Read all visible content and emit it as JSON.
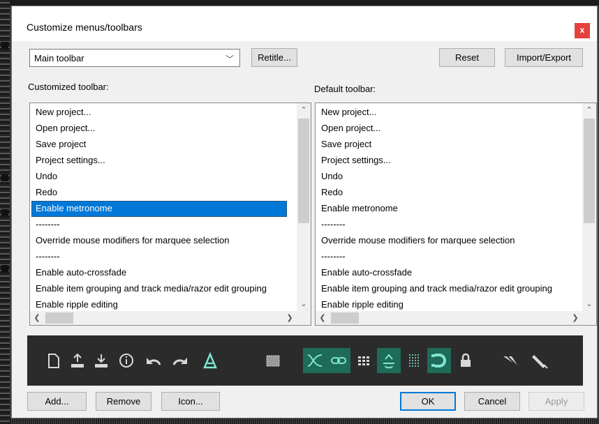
{
  "dialog": {
    "title": "Customize menus/toolbars",
    "close_glyph": "x"
  },
  "toolbar_select": {
    "value": "Main toolbar",
    "chevron": "﹀"
  },
  "buttons": {
    "retitle": "Retitle...",
    "reset": "Reset",
    "import_export": "Import/Export",
    "add": "Add...",
    "remove": "Remove",
    "icon": "Icon...",
    "ok": "OK",
    "cancel": "Cancel",
    "apply": "Apply"
  },
  "labels": {
    "customized": "Customized toolbar:",
    "default": "Default toolbar:"
  },
  "customized_items": [
    "New project...",
    "Open project...",
    "Save project",
    "Project settings...",
    "Undo",
    "Redo",
    "Enable metronome",
    "--------",
    "Override mouse modifiers for marquee selection",
    "--------",
    "Enable auto-crossfade",
    "Enable item grouping and track media/razor edit grouping",
    "Enable ripple editing"
  ],
  "customized_selected_index": 6,
  "default_items": [
    "New project...",
    "Open project...",
    "Save project",
    "Project settings...",
    "Undo",
    "Redo",
    "Enable metronome",
    "--------",
    "Override mouse modifiers for marquee selection",
    "--------",
    "Enable auto-crossfade",
    "Enable item grouping and track media/razor edit grouping",
    "Enable ripple editing"
  ],
  "toolbar_preview_icons": [
    {
      "name": "new-project-icon",
      "active": false
    },
    {
      "name": "open-project-icon",
      "active": false
    },
    {
      "name": "save-project-icon",
      "active": false
    },
    {
      "name": "project-settings-icon",
      "active": false
    },
    {
      "name": "undo-icon",
      "active": false
    },
    {
      "name": "redo-icon",
      "active": false
    },
    {
      "name": "metronome-icon",
      "active": false
    },
    {
      "name": "marquee-selection-icon",
      "active": false
    },
    {
      "name": "auto-crossfade-icon",
      "active": true
    },
    {
      "name": "item-grouping-icon",
      "active": true
    },
    {
      "name": "ripple-editing-icon",
      "active": false
    },
    {
      "name": "snap-icon",
      "active": true
    },
    {
      "name": "grid-icon",
      "active": false
    },
    {
      "name": "locking-icon",
      "active": true
    },
    {
      "name": "lock-icon",
      "active": false
    },
    {
      "name": "envelope-points-icon",
      "active": false
    },
    {
      "name": "pencil-icon",
      "active": false
    }
  ],
  "colors": {
    "selection": "#0078d7",
    "close": "#e4413b",
    "toolbar_bg": "#2b2b2b",
    "active_icon_bg": "#1e6b5a"
  }
}
